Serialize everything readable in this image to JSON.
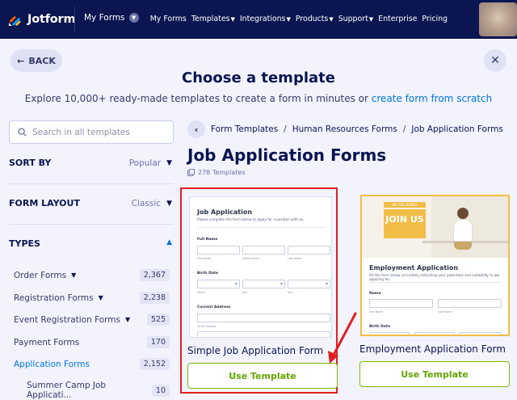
{
  "header": {
    "logo_text": "Jotform",
    "my_forms": "My Forms",
    "nav": [
      {
        "label": "My Forms",
        "dropdown": false
      },
      {
        "label": "Templates",
        "dropdown": true
      },
      {
        "label": "Integrations",
        "dropdown": true
      },
      {
        "label": "Products",
        "dropdown": true
      },
      {
        "label": "Support",
        "dropdown": true
      },
      {
        "label": "Enterprise",
        "dropdown": false
      },
      {
        "label": "Pricing",
        "dropdown": false
      }
    ]
  },
  "page": {
    "back_label": "BACK",
    "title": "Choose a template",
    "subtitle_text": "Explore 10,000+ ready-made templates to create a form in minutes or ",
    "subtitle_link": "create form from scratch"
  },
  "sidebar": {
    "search_placeholder": "Search in all templates",
    "sort_by": {
      "label": "SORT BY",
      "value": "Popular"
    },
    "form_layout": {
      "label": "FORM LAYOUT",
      "value": "Classic"
    },
    "types_label": "TYPES",
    "categories": [
      {
        "name": "Order Forms",
        "count": "2,367",
        "dropdown": true
      },
      {
        "name": "Registration Forms",
        "count": "2,238",
        "dropdown": true
      },
      {
        "name": "Event Registration Forms",
        "count": "525",
        "dropdown": true
      },
      {
        "name": "Payment Forms",
        "count": "170",
        "dropdown": false
      },
      {
        "name": "Application Forms",
        "count": "2,152",
        "dropdown": false
      },
      {
        "name": "Summer Camp Job Applicati...",
        "count": "10",
        "dropdown": false
      }
    ]
  },
  "main": {
    "breadcrumb": [
      "Form Templates",
      "Human Resources Forms",
      "Job Application Forms"
    ],
    "category_title": "Job Application Forms",
    "template_count": "278 Templates",
    "cards": [
      {
        "title": "Simple Job Application Form",
        "button": "Use Template",
        "highlighted": true,
        "preview": {
          "title": "Job Application",
          "subtitle": "Please complete the form below to apply for a position with us.",
          "full_name": "Full Name",
          "name_parts": [
            "First Name",
            "Middle Name",
            "Last Name"
          ],
          "birth_date": "Birth Date",
          "date_parts": [
            "Month",
            "Day",
            "Year"
          ],
          "current_address": "Current Address",
          "street_address": "Street Address"
        }
      },
      {
        "title": "Employment Application Form",
        "button": "Use Template",
        "highlighted": false,
        "preview": {
          "banner_small": "WE ARE HIRING",
          "banner_big": "JOIN US",
          "title": "Employment Application",
          "subtitle": "Fill the form below accurately indicating your potentials and suitability to job applying for.",
          "name": "Name",
          "name_parts": [
            "First Name",
            "Last Name"
          ],
          "birth_date": "Birth Date"
        }
      }
    ]
  },
  "colors": {
    "navy": "#0a1551",
    "link_blue": "#0075e3",
    "green": "#64a400",
    "highlight_red": "#e02020",
    "accent_yellow": "#f2bd47",
    "logo_orange": "#ff6100"
  }
}
